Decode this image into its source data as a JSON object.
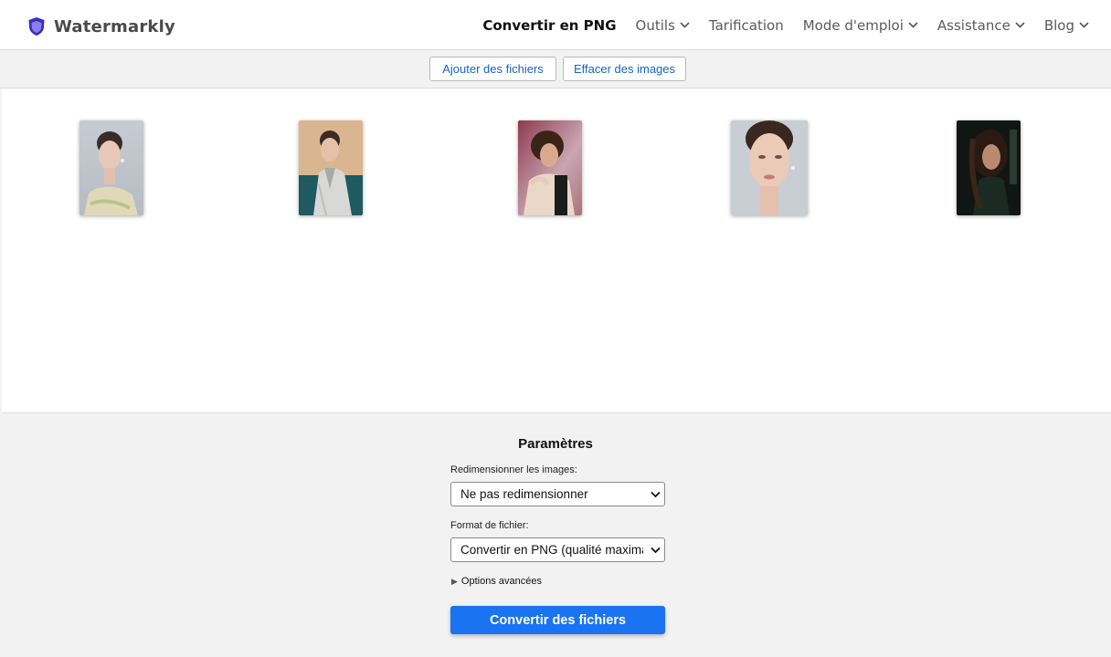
{
  "brand": {
    "name": "Watermarkly",
    "icon": "shield-icon",
    "accent": "#5b4fd6"
  },
  "nav": {
    "items": [
      {
        "label": "Convertir en PNG",
        "active": true,
        "dropdown": false
      },
      {
        "label": "Outils",
        "active": false,
        "dropdown": true
      },
      {
        "label": "Tarification",
        "active": false,
        "dropdown": false
      },
      {
        "label": "Mode d'emploi",
        "active": false,
        "dropdown": true
      },
      {
        "label": "Assistance",
        "active": false,
        "dropdown": true
      },
      {
        "label": "Blog",
        "active": false,
        "dropdown": true
      }
    ]
  },
  "toolbar": {
    "add_label": "Ajouter des fichiers",
    "clear_label": "Effacer des images"
  },
  "gallery": {
    "count": 5
  },
  "settings": {
    "title": "Paramètres",
    "resize_label": "Redimensionner les images:",
    "resize_value": "Ne pas redimensionner",
    "format_label": "Format de fichier:",
    "format_value": "Convertir en PNG (qualité maximale)",
    "advanced_label": "Options avancées",
    "convert_label": "Convertir des fichiers"
  },
  "colors": {
    "primary": "#1a73f0",
    "link": "#1565c0"
  }
}
